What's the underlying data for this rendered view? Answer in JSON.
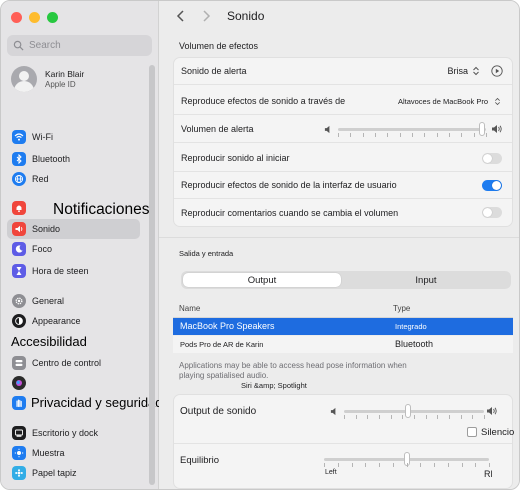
{
  "window": {
    "title": "Sonido"
  },
  "sidebar": {
    "search_placeholder": "Search",
    "profile": {
      "name": "Karin Blair",
      "subtitle": "Apple ID"
    },
    "items": [
      {
        "label": "Wi-Fi",
        "icon": "wifi-icon",
        "color": "#1e7cf0"
      },
      {
        "label": "Bluetooth",
        "icon": "bluetooth-icon",
        "color": "#1e7cf0"
      },
      {
        "label": "Red",
        "icon": "globe-icon",
        "color": "#1e7cf0"
      },
      {
        "label": "Notificaciones",
        "icon": "bell-icon",
        "color": "#f0463c"
      },
      {
        "label": "Sonido",
        "icon": "speaker-icon",
        "color": "#f0463c",
        "selected": true
      },
      {
        "label": "Foco",
        "icon": "moon-icon",
        "color": "#5e5ce6"
      },
      {
        "label": "Hora de steen",
        "icon": "hourglass-icon",
        "color": "#5e5ce6"
      },
      {
        "label": "General",
        "icon": "gear-icon",
        "color": "#8e8e93"
      },
      {
        "label": "Appearance",
        "icon": "appearance-icon",
        "color": "#1d1d1f"
      },
      {
        "label": "Accesibilidad",
        "icon": "accessibility-icon",
        "color": "#1e7cf0"
      },
      {
        "label": "Centro de control",
        "icon": "control-center-icon",
        "color": "#8e8e93"
      },
      {
        "label": "",
        "icon": "siri-icon",
        "color": "#2b2b2b"
      },
      {
        "label": "Privacidad y seguridad",
        "icon": "hand-icon",
        "color": "#1e7cf0"
      },
      {
        "label": "Escritorio y dock",
        "icon": "dock-icon",
        "color": "#1d1d1f"
      },
      {
        "label": "Muestra",
        "icon": "display-icon",
        "color": "#1e7cf0"
      },
      {
        "label": "Papel tapiz",
        "icon": "wallpaper-icon",
        "color": "#32ade6"
      }
    ]
  },
  "effects": {
    "section_title": "Volumen de efectos",
    "alert_sound_label": "Sonido de alerta",
    "alert_sound_value": "Brisa",
    "play_effects_label": "Reproduce efectos de sonido a través de",
    "play_effects_value": "Altavoces de MacBook Pro",
    "alert_volume_label": "Volumen de alerta",
    "alert_volume_level": 0.97,
    "startup_label": "Reproducir sonido al iniciar",
    "startup_on": false,
    "ui_effects_label": "Reproducir efectos de sonido de la interfaz de usuario",
    "ui_effects_on": true,
    "volume_feedback_label": "Reproducir comentarios cuando se cambia el volumen",
    "volume_feedback_on": false
  },
  "output_input": {
    "section_title": "Salida y entrada",
    "tab_output": "Output",
    "tab_input": "Input",
    "col_name": "Name",
    "col_type": "Type",
    "devices": [
      {
        "name": "MacBook Pro Speakers",
        "type": "Integrado",
        "selected": true
      },
      {
        "name": "Pods Pro de AR de Karin",
        "type": "Bluetooth",
        "selected": false
      }
    ],
    "note": "Applications may be able to access head pose information when playing spatialised audio.",
    "note_link": "Siri &amp; Spotlight",
    "output_volume_label": "Output de sonido",
    "output_volume_level": 0.46,
    "mute_label": "Silencio",
    "balance_label": "Equilibrio",
    "balance_left": "Left",
    "balance_right": "Rl",
    "balance_level": 0.5
  }
}
